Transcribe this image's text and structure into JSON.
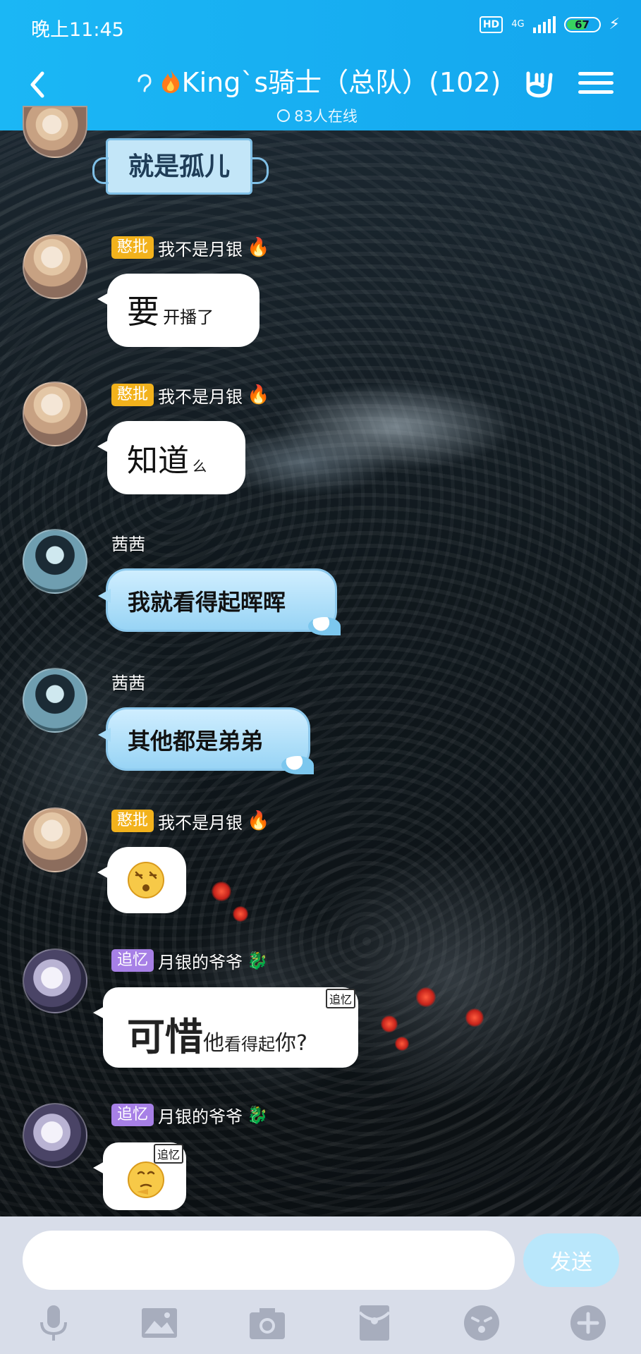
{
  "status_bar": {
    "time": "晚上11:45",
    "hd": "HD",
    "network": "4G",
    "battery": "67",
    "battery_level": 0.67
  },
  "header": {
    "title": "King`s骑士（总队）(102)",
    "online_text": "83人在线",
    "icons": [
      "back-icon",
      "ear-icon",
      "flame-icon",
      "rock-hand-icon",
      "menu-icon"
    ]
  },
  "messages": [
    {
      "sender": "",
      "tag": "",
      "text": "就是孤儿",
      "style": "framed"
    },
    {
      "sender": "我不是月银",
      "tag": "憨批",
      "text_big": "要",
      "text_small": "开播了",
      "style": "white"
    },
    {
      "sender": "我不是月银",
      "tag": "憨批",
      "text_big": "知道",
      "text_small": "么",
      "style": "white"
    },
    {
      "sender": "茜茜",
      "tag": "",
      "text": "我就看得起晖晖",
      "style": "blue"
    },
    {
      "sender": "茜茜",
      "tag": "",
      "text": "其他都是弟弟",
      "style": "blue"
    },
    {
      "sender": "我不是月银",
      "tag": "憨批",
      "emoji": "dizzy-face-emoji",
      "style": "white"
    },
    {
      "sender": "月银的爷爷",
      "tag": "追忆",
      "t1": "可惜",
      "t2": "他",
      "t3": "看得起",
      "t4": "你?",
      "corner": "追忆",
      "style": "white"
    },
    {
      "sender": "月银的爷爷",
      "tag": "追忆",
      "emoji": "thinking-face-emoji",
      "corner": "追忆",
      "style": "white"
    }
  ],
  "input": {
    "value": "",
    "send_label": "发送"
  },
  "toolbar": [
    "microphone-icon",
    "image-icon",
    "camera-icon",
    "red-packet-icon",
    "emoji-icon",
    "plus-icon"
  ],
  "colors": {
    "header": "#14a6ee",
    "tag_yellow": "#f2b21c",
    "tag_purple": "#a780e6",
    "send_button": "#b9e7fb"
  }
}
